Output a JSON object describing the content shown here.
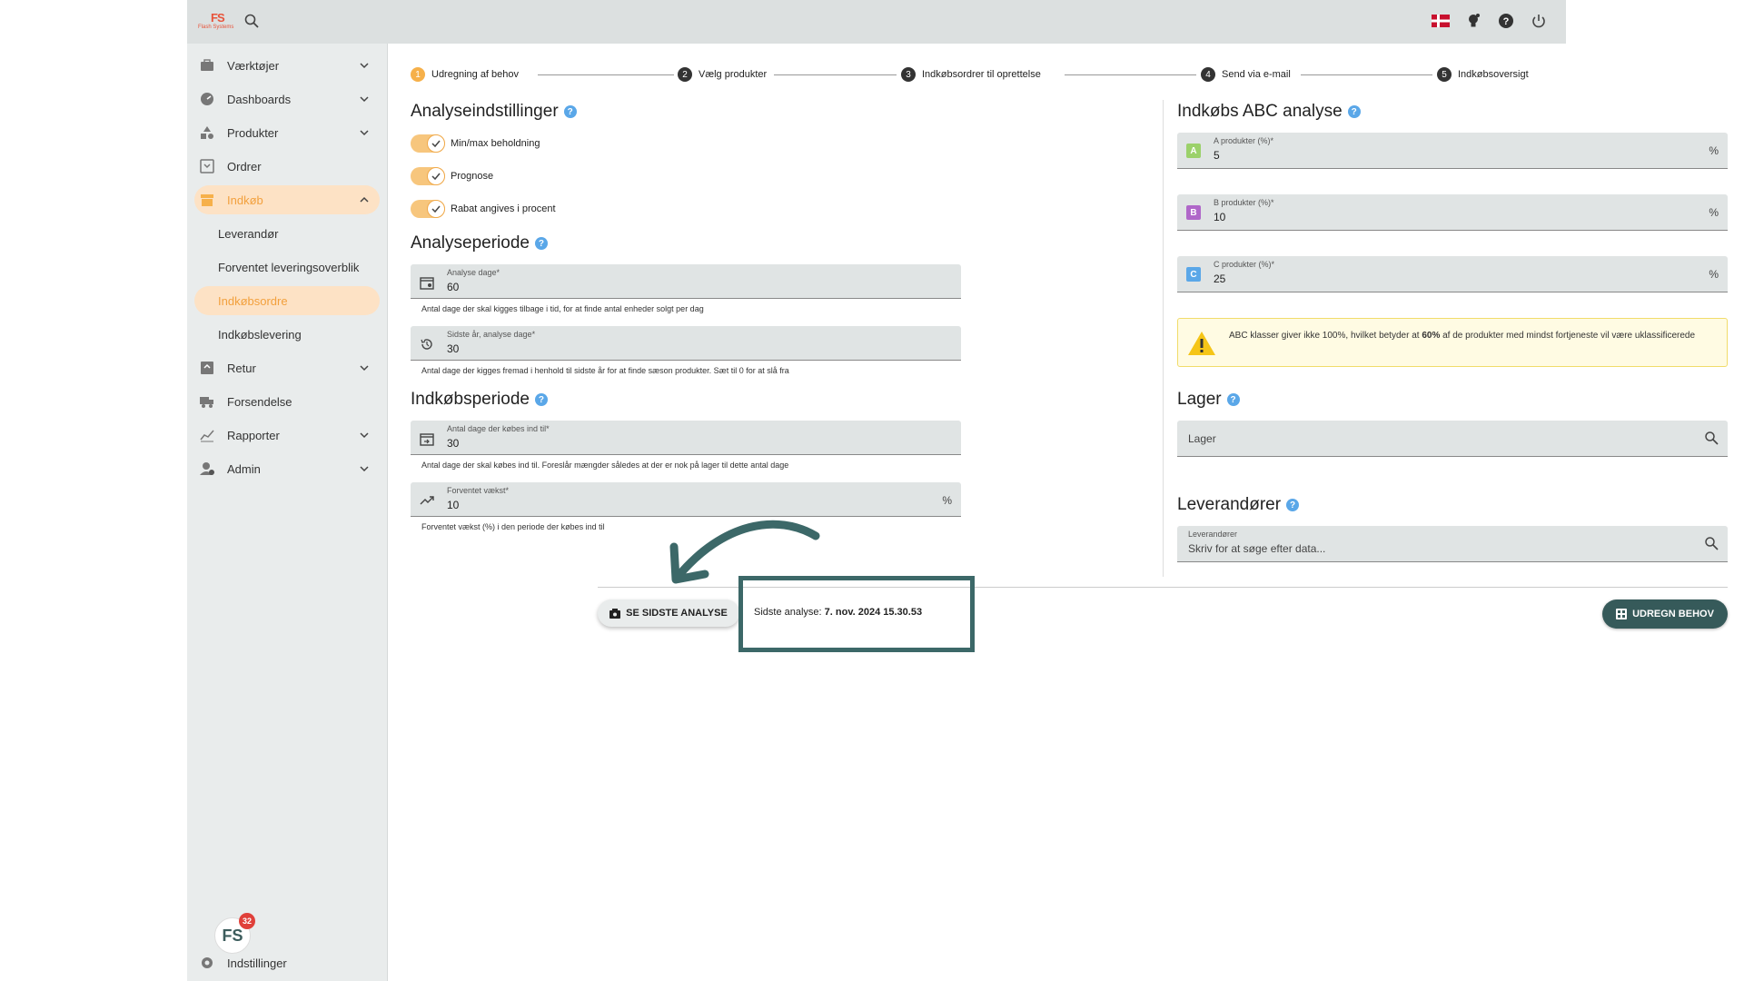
{
  "topbar": {
    "logo_mark": "FS",
    "logo_sub": "Flash Systems",
    "flag_color": "#c8102e"
  },
  "sidebar": {
    "items": [
      {
        "label": "Værktøjer",
        "icon": "toolbox-icon",
        "expandable": true
      },
      {
        "label": "Dashboards",
        "icon": "speedometer-icon",
        "expandable": true
      },
      {
        "label": "Produkter",
        "icon": "shapes-icon",
        "expandable": true
      },
      {
        "label": "Ordrer",
        "icon": "inbox-icon",
        "expandable": false
      },
      {
        "label": "Indkøb",
        "icon": "store-icon",
        "expandable": true,
        "active": true
      },
      {
        "label": "Retur",
        "icon": "return-icon",
        "expandable": true
      },
      {
        "label": "Forsendelse",
        "icon": "truck-icon",
        "expandable": false
      },
      {
        "label": "Rapporter",
        "icon": "chart-icon",
        "expandable": true
      },
      {
        "label": "Admin",
        "icon": "admin-icon",
        "expandable": true
      }
    ],
    "subitems": [
      {
        "label": "Leverandør"
      },
      {
        "label": "Forventet leveringsoverblik"
      },
      {
        "label": "Indkøbsordre",
        "active": true
      },
      {
        "label": "Indkøbslevering"
      }
    ],
    "avatar_text": "FS",
    "avatar_badge": "32",
    "settings_label": "Indstillinger"
  },
  "stepper": {
    "steps": [
      {
        "num": "1",
        "label": "Udregning af behov",
        "active": true
      },
      {
        "num": "2",
        "label": "Vælg produkter"
      },
      {
        "num": "3",
        "label": "Indkøbsordrer til oprettelse"
      },
      {
        "num": "4",
        "label": "Send via e-mail"
      },
      {
        "num": "5",
        "label": "Indkøbsoversigt"
      }
    ]
  },
  "settings": {
    "title": "Analyseindstillinger",
    "toggles": [
      {
        "label": "Min/max beholdning",
        "on": true
      },
      {
        "label": "Prognose",
        "on": true
      },
      {
        "label": "Rabat angives i procent",
        "on": true
      }
    ]
  },
  "period": {
    "title": "Analyseperiode",
    "days_label": "Analyse dage*",
    "days_value": "60",
    "days_hint": "Antal dage der skal kigges tilbage i tid, for at finde antal enheder solgt per dag",
    "lastyear_label": "Sidste år, analyse dage*",
    "lastyear_value": "30",
    "lastyear_hint": "Antal dage der kigges fremad i henhold til sidste år for at finde sæson produkter. Sæt til 0 for at slå fra"
  },
  "purchase": {
    "title": "Indkøbsperiode",
    "days_label": "Antal dage der købes ind til*",
    "days_value": "30",
    "days_hint": "Antal dage der skal købes ind til. Foreslår mængder således at der er nok på lager til dette antal dage",
    "growth_label": "Forventet vækst*",
    "growth_value": "10",
    "growth_suffix": "%",
    "growth_hint": "Forventet vækst (%) i den periode der købes ind til"
  },
  "abc": {
    "title": "Indkøbs ABC analyse",
    "a": {
      "badge": "A",
      "label": "A produkter (%)*",
      "value": "5",
      "suffix": "%",
      "color": "#9bd16a"
    },
    "b": {
      "badge": "B",
      "label": "B produkter (%)*",
      "value": "10",
      "suffix": "%",
      "color": "#b067c9"
    },
    "c": {
      "badge": "C",
      "label": "C produkter (%)*",
      "value": "25",
      "suffix": "%",
      "color": "#5aa7e8"
    },
    "warning_pre": "ABC klasser giver ikke 100%, hvilket betyder at ",
    "warning_bold": "60%",
    "warning_post": " af de produkter med mindst fortjeneste vil være uklassificerede"
  },
  "lager": {
    "title": "Lager",
    "placeholder": "Lager"
  },
  "suppliers": {
    "title": "Leverandører",
    "label": "Leverandører",
    "placeholder": "Skriv for at søge efter data..."
  },
  "footer": {
    "last_button": "SE SIDSTE ANALYSE",
    "last_prefix": "Sidste analyse: ",
    "last_date": "7. nov. 2024 15.30.53",
    "calc_button": "UDREGN BEHOV",
    "annotation_color": "#3c6868"
  }
}
